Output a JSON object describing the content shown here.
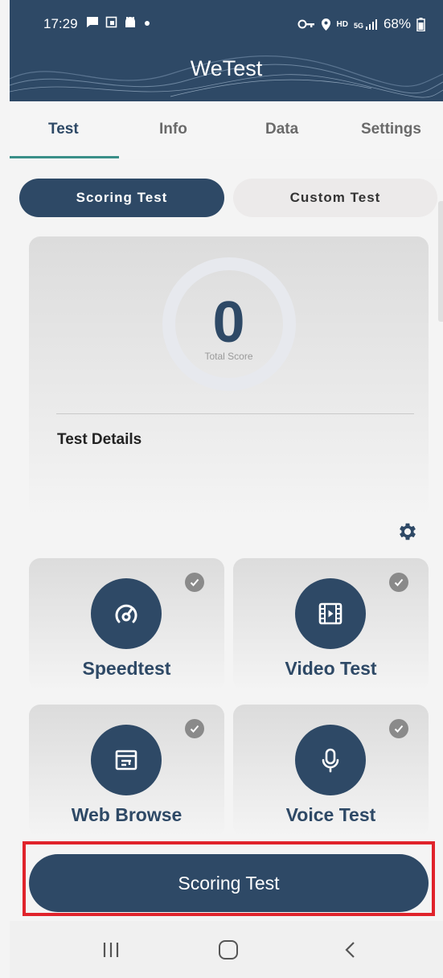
{
  "statusbar": {
    "time": "17:29",
    "right_text": "68%",
    "icons_left": [
      "message-icon",
      "screenshot-icon",
      "android-icon",
      "dot-icon"
    ],
    "icons_right": [
      "vpn-key-icon",
      "location-icon",
      "hd-icon",
      "5g-signal-icon",
      "battery-icon"
    ],
    "hd_label": "HD",
    "network_label": "5G"
  },
  "app": {
    "title": "WeTest"
  },
  "tabs": [
    {
      "label": "Test",
      "active": true
    },
    {
      "label": "Info",
      "active": false
    },
    {
      "label": "Data",
      "active": false
    },
    {
      "label": "Settings",
      "active": false
    }
  ],
  "mode": {
    "scoring": "Scoring Test",
    "custom": "Custom Test"
  },
  "score": {
    "value": "0",
    "label": "Total Score",
    "details_title": "Test Details"
  },
  "tests": [
    {
      "label": "Speedtest",
      "icon": "speedometer-icon",
      "checked": true
    },
    {
      "label": "Video Test",
      "icon": "film-icon",
      "checked": true
    },
    {
      "label": "Web Browse",
      "icon": "browser-icon",
      "checked": true
    },
    {
      "label": "Voice Test",
      "icon": "microphone-icon",
      "checked": true
    }
  ],
  "action": {
    "label": "Scoring Test"
  },
  "colors": {
    "primary": "#2e4966",
    "accent_underline": "#3a8f88",
    "highlight": "#e0232b"
  }
}
